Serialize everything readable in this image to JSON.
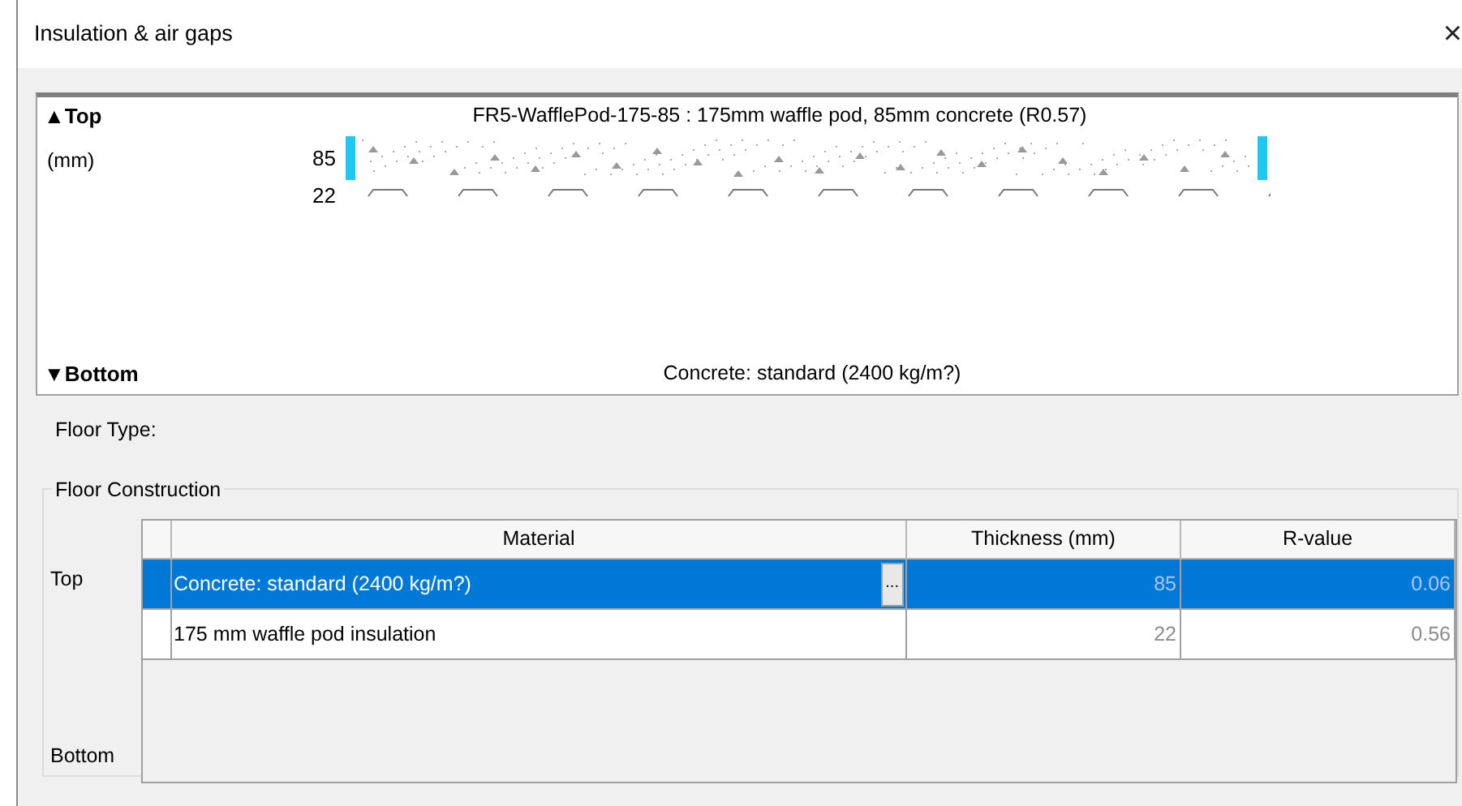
{
  "window": {
    "title": "Insulation & air gaps",
    "close": "×"
  },
  "diagram": {
    "top_label": "▲Top",
    "bottom_label": "▼Bottom",
    "unit": "(mm)",
    "heading": "FR5-WafflePod-175-85 : 175mm waffle pod, 85mm concrete (R0.57)",
    "footer": "Concrete: standard (2400 kg/m?)",
    "layers": [
      {
        "kind": "concrete",
        "thickness": "85"
      },
      {
        "kind": "pods",
        "thickness": "22"
      }
    ]
  },
  "floor_type_label": "Floor Type:",
  "construction": {
    "legend": "Floor Construction",
    "top_label": "Top",
    "bottom_label": "Bottom",
    "columns": [
      "Material",
      "Thickness (mm)",
      "R-value"
    ],
    "rows": [
      {
        "material": "Concrete: standard (2400 kg/m?)",
        "button": "...",
        "thickness": "85",
        "r_value": "0.06",
        "selected": true
      },
      {
        "material": "175 mm waffle pod insulation",
        "thickness": "22",
        "r_value": "0.56",
        "selected": false
      }
    ]
  }
}
